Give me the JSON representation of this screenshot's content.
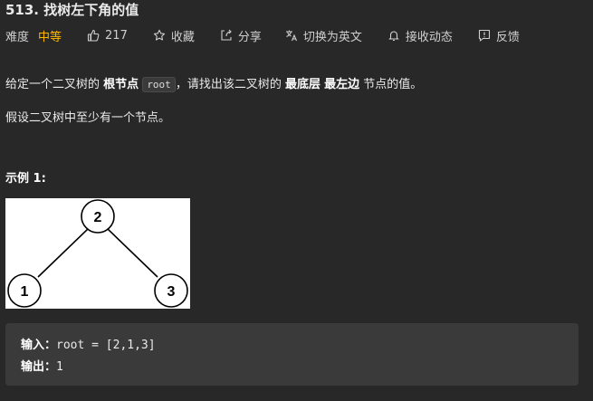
{
  "problem": {
    "title": "513. 找树左下角的值"
  },
  "meta": {
    "difficulty_label": "难度",
    "difficulty_value": "中等",
    "likes": "217",
    "favorite_label": "收藏",
    "share_label": "分享",
    "translate_label": "切换为英文",
    "subscribe_label": "接收动态",
    "feedback_label": "反馈"
  },
  "description": {
    "p1_a": "给定一个二叉树的",
    "p1_b": "根节点",
    "p1_code": "root",
    "p1_c": "，请找出该二叉树的",
    "p1_d": "最底层",
    "p1_e": "最左边",
    "p1_f": "节点的值。",
    "p2": "假设二叉树中至少有一个节点。"
  },
  "example": {
    "title": "示例 1:",
    "tree_nodes": [
      "2",
      "1",
      "3"
    ],
    "input_label": "输入：",
    "input_value": "root = [2,1,3]",
    "output_label": "输出：",
    "output_value": "1"
  },
  "icons": [
    "thumbs-up-icon",
    "star-icon",
    "share-icon",
    "translate-icon",
    "bell-icon",
    "feedback-icon"
  ],
  "colors": {
    "background": "#282828",
    "difficulty_medium": "#ffb800",
    "code_box": "#3a3a3a"
  }
}
